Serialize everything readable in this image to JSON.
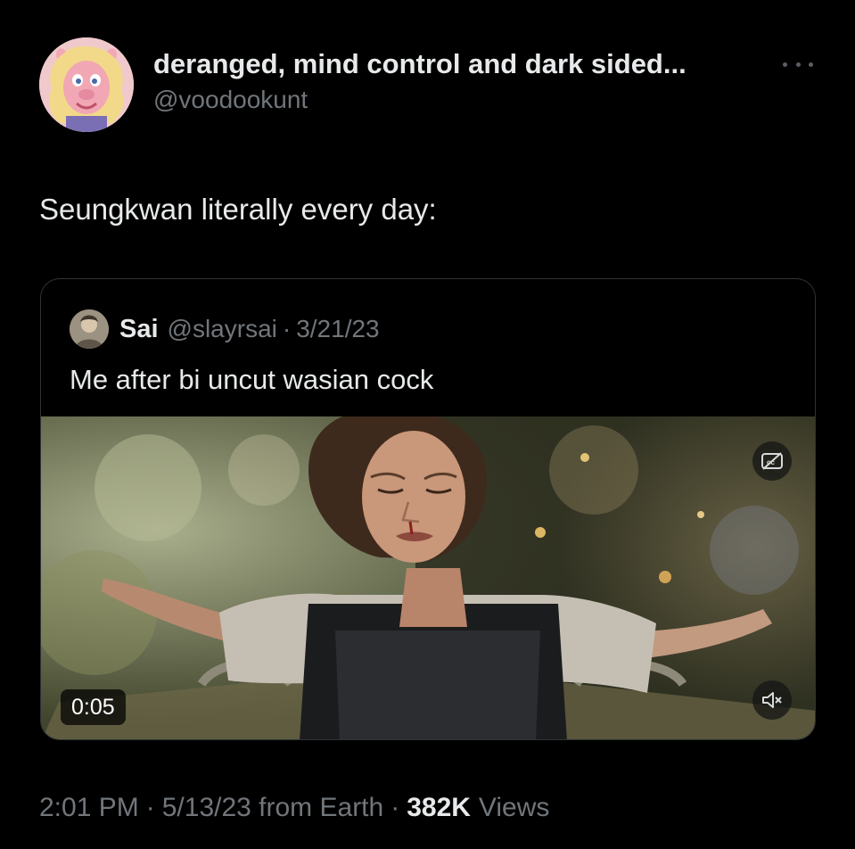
{
  "author": {
    "display_name": "deranged, mind control and dark sided...",
    "handle": "@voodookunt",
    "avatar_icon": "muppet-avatar-icon"
  },
  "tweet": {
    "text": "Seungkwan literally every day:"
  },
  "quoted_tweet": {
    "name": "Sai",
    "handle": "@slayrsai",
    "separator": "·",
    "date": "3/21/23",
    "text": "Me after bi uncut wasian cock",
    "media": {
      "type": "video",
      "duration": "0:05",
      "captions_icon": "closed-captions-off-icon",
      "mute_icon": "speaker-muted-icon"
    }
  },
  "meta": {
    "time": "2:01 PM",
    "separator": "·",
    "date_source": "5/13/23 from Earth",
    "views_count": "382K",
    "views_label": "Views"
  },
  "colors": {
    "background": "#000000",
    "primary_text": "#e7e9ea",
    "secondary_text": "#71767b",
    "border": "#2f3336"
  }
}
